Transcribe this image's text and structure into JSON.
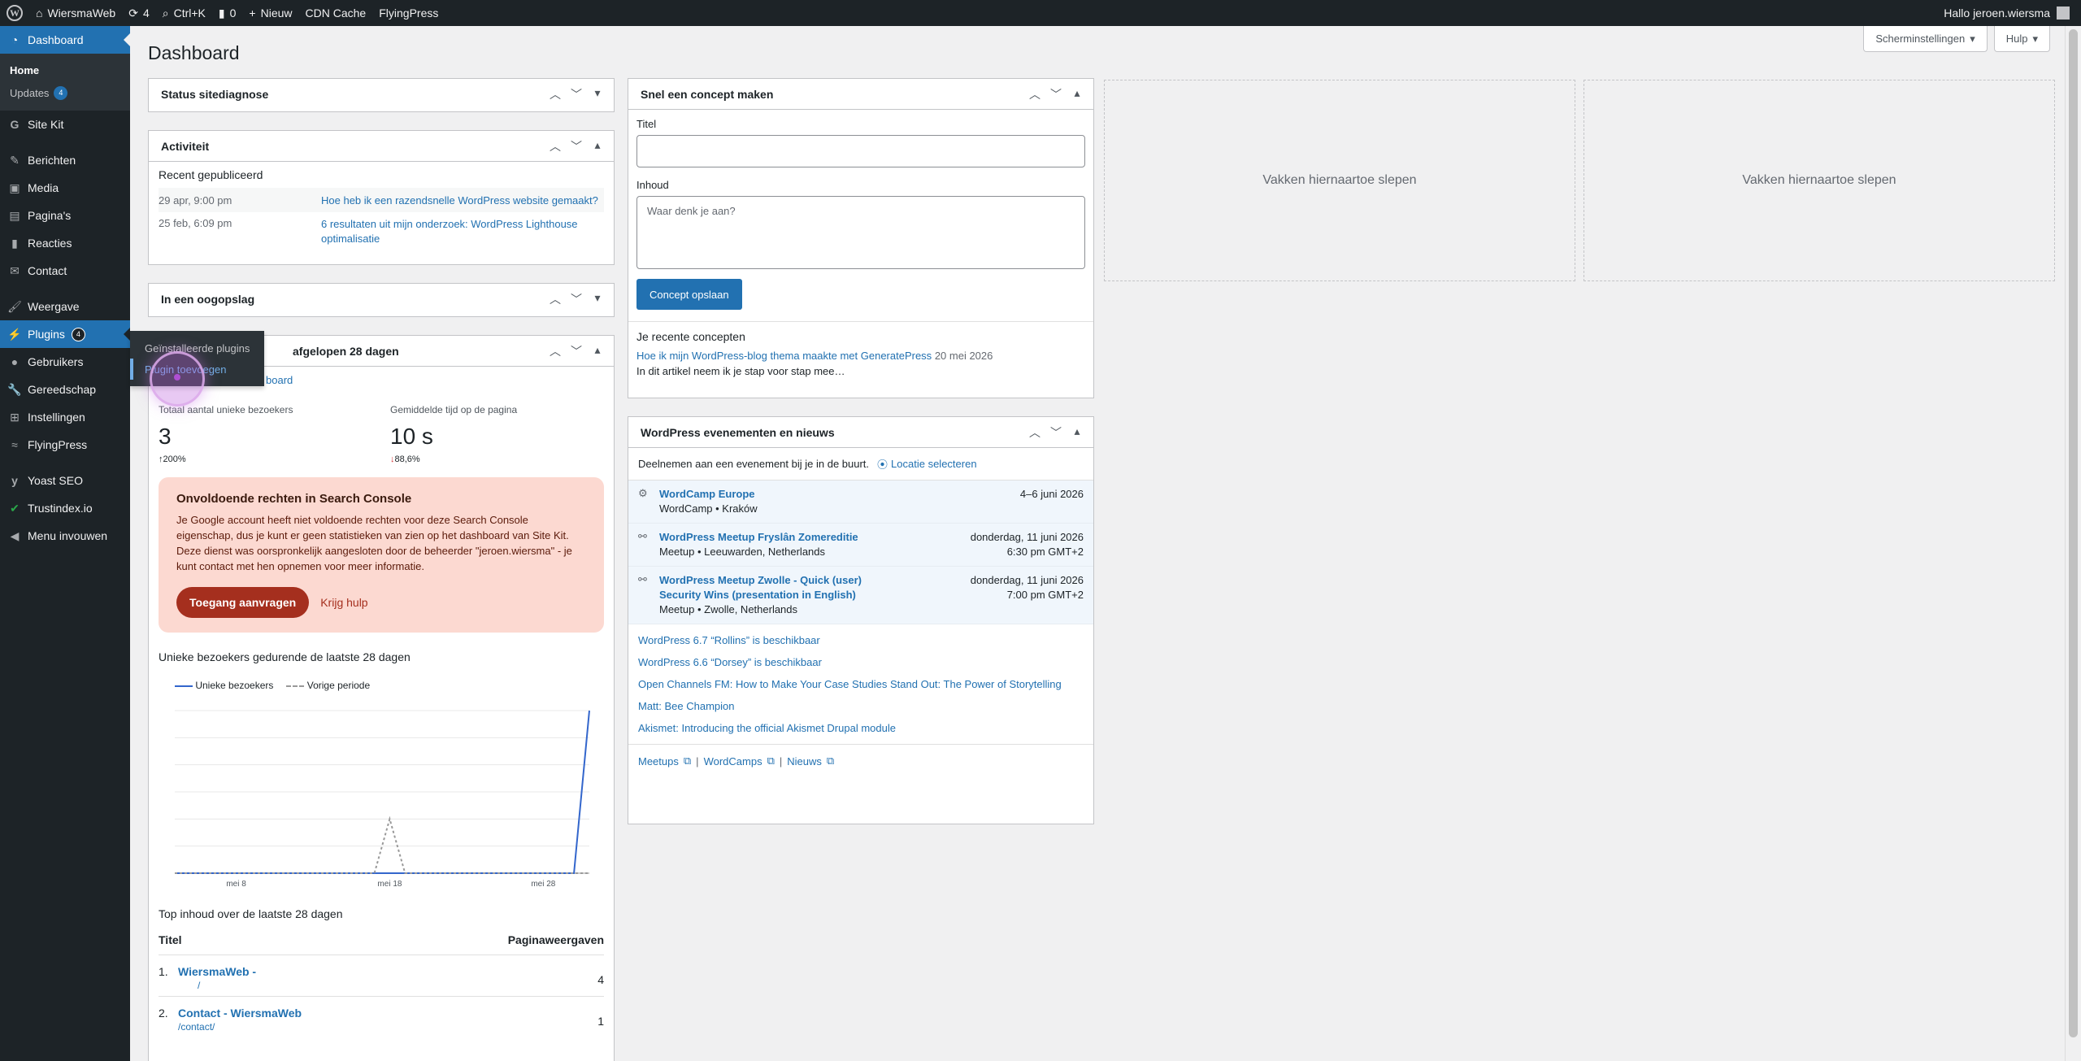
{
  "adminbar": {
    "site_name": "WiersmaWeb",
    "updates_count": "4",
    "search_label": "Ctrl+K",
    "comments_count": "0",
    "new_label": "Nieuw",
    "cdn_label": "CDN Cache",
    "flyingpress_label": "FlyingPress",
    "greeting": "Hallo jeroen.wiersma"
  },
  "menu": {
    "dashboard": "Dashboard",
    "home": "Home",
    "updates": "Updates",
    "updates_badge": "4",
    "sitekit": "Site Kit",
    "berichten": "Berichten",
    "media": "Media",
    "paginas": "Pagina's",
    "reacties": "Reacties",
    "contact": "Contact",
    "weergave": "Weergave",
    "plugins": "Plugins",
    "plugins_badge": "4",
    "gebruikers": "Gebruikers",
    "gereedschap": "Gereedschap",
    "instellingen": "Instellingen",
    "flyingpress": "FlyingPress",
    "yoast": "Yoast SEO",
    "trustindex": "Trustindex.io",
    "collapse": "Menu invouwen"
  },
  "flyout": {
    "installed": "Geïnstalleerde plugins",
    "add": "Plugin toevoegen"
  },
  "header": {
    "title": "Dashboard",
    "screen_options": "Scherminstellingen",
    "help": "Hulp"
  },
  "site_health": {
    "title": "Status sitediagnose"
  },
  "activity": {
    "title": "Activiteit",
    "recent_label": "Recent gepubliceerd",
    "items": [
      {
        "date": "29 apr, 9:00 pm",
        "title": "Hoe heb ik een razendsnelle WordPress website gemaakt?"
      },
      {
        "date": "25 feb, 6:09 pm",
        "title": "6 resultaten uit mijn onderzoek: WordPress Lighthouse optimalisatie"
      }
    ]
  },
  "glance": {
    "title": "In een oogopslag"
  },
  "sitekit": {
    "title_partial": "afgelopen 28 dagen",
    "dashboard_link": "board",
    "visitors_label": "Totaal aantal unieke bezoekers",
    "visitors_value": "3",
    "visitors_delta": "200%",
    "time_label": "Gemiddelde tijd op de pagina",
    "time_value": "10 s",
    "time_delta": "88,6%",
    "notice_title": "Onvoldoende rechten in Search Console",
    "notice_text": "Je Google account heeft niet voldoende rechten voor deze Search Console eigenschap, dus je kunt er geen statistieken van zien op het dashboard van Site Kit. Deze dienst was oorspronkelijk aangesloten door de beheerder \"jeroen.wiersma\" - je kunt contact met hen opnemen voor meer informatie.",
    "request_button": "Toegang aanvragen",
    "help_link": "Krijg hulp",
    "chart_title": "Unieke bezoekers gedurende de laatste 28 dagen",
    "legend_current": "Unieke bezoekers",
    "legend_previous": "Vorige periode",
    "top_title": "Top inhoud over de laatste 28 dagen",
    "col_title": "Titel",
    "col_views": "Paginaweergaven",
    "rows": [
      {
        "num": "1.",
        "title": "WiersmaWeb -",
        "path": "/",
        "views": "4"
      },
      {
        "num": "2.",
        "title": "Contact - WiersmaWeb",
        "path": "/contact/",
        "views": "1"
      }
    ]
  },
  "chart_data": {
    "type": "line",
    "title": "Unieke bezoekers gedurende de laatste 28 dagen",
    "x_tick_labels": [
      "mei 8",
      "mei 18",
      "mei 28"
    ],
    "days": 28,
    "ylim": [
      0,
      3
    ],
    "grid": true,
    "legend_placement": "top-left",
    "series": [
      {
        "name": "Unieke bezoekers",
        "style": "solid",
        "color": "#3366cc",
        "values": [
          0,
          0,
          0,
          0,
          0,
          0,
          0,
          0,
          0,
          0,
          0,
          0,
          0,
          0,
          0,
          0,
          0,
          0,
          0,
          0,
          0,
          0,
          0,
          0,
          0,
          0,
          0,
          3
        ]
      },
      {
        "name": "Vorige periode",
        "style": "dashed",
        "color": "#999999",
        "values": [
          0,
          0,
          0,
          0,
          0,
          0,
          0,
          0,
          0,
          0,
          0,
          0,
          0,
          0,
          1,
          0,
          0,
          0,
          0,
          0,
          0,
          0,
          0,
          0,
          0,
          0,
          0,
          0
        ]
      }
    ]
  },
  "quickdraft": {
    "title": "Snel een concept maken",
    "title_label": "Titel",
    "content_label": "Inhoud",
    "content_placeholder": "Waar denk je aan?",
    "save_button": "Concept opslaan",
    "recent_label": "Je recente concepten",
    "draft_title": "Hoe ik mijn WordPress-blog thema maakte met GeneratePress",
    "draft_date": "20 mei 2026",
    "draft_excerpt": "In dit artikel neem ik je stap voor stap mee…"
  },
  "events": {
    "title": "WordPress evenementen en nieuws",
    "intro": "Deelnemen aan een evenement bij je in de buurt.",
    "location_link": "Locatie selecteren",
    "items": [
      {
        "title": "WordCamp Europe",
        "sub": "WordCamp • Kraków",
        "date": "4–6 juni 2026",
        "time": ""
      },
      {
        "title": "WordPress Meetup Fryslân Zomereditie",
        "sub": "Meetup • Leeuwarden, Netherlands",
        "date": "donderdag, 11 juni 2026",
        "time": "6:30 pm GMT+2"
      },
      {
        "title": "WordPress Meetup Zwolle - Quick (user) Security Wins (presentation in English)",
        "sub": "Meetup • Zwolle, Netherlands",
        "date": "donderdag, 11 juni 2026",
        "time": "7:00 pm GMT+2"
      }
    ],
    "news": [
      "WordPress 6.7 “Rollins” is beschikbaar",
      "WordPress 6.6 “Dorsey” is beschikbaar",
      "Open Channels FM: How to Make Your Case Studies Stand Out: The Power of Storytelling",
      "Matt: Bee Champion",
      "Akismet: Introducing the official Akismet Drupal module"
    ],
    "footer_meetups": "Meetups",
    "footer_wordcamps": "WordCamps",
    "footer_news": "Nieuws",
    "footer_sep": "|"
  },
  "dropzones": {
    "label": "Vakken hiernaartoe slepen"
  }
}
